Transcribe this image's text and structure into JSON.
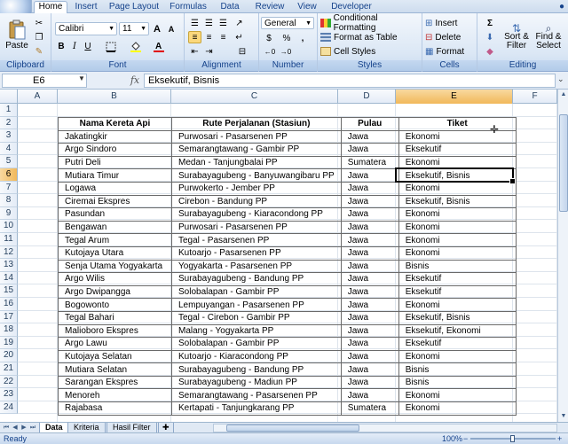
{
  "ribbon": {
    "tabs": [
      "Home",
      "Insert",
      "Page Layout",
      "Formulas",
      "Data",
      "Review",
      "View",
      "Developer"
    ],
    "active_tab": "Home",
    "clipboard": {
      "label": "Clipboard",
      "paste": "Paste"
    },
    "font": {
      "label": "Font",
      "name": "Calibri",
      "size": "11",
      "bold": "B",
      "italic": "I",
      "underline": "U"
    },
    "alignment": {
      "label": "Alignment"
    },
    "number": {
      "label": "Number",
      "format": "General",
      "currency": "$",
      "percent": "%",
      "comma": ","
    },
    "styles": {
      "label": "Styles",
      "conditional": "Conditional Formatting",
      "format_table": "Format as Table",
      "cell_styles": "Cell Styles"
    },
    "cells": {
      "label": "Cells",
      "insert": "Insert",
      "delete": "Delete",
      "format": "Format"
    },
    "editing": {
      "label": "Editing",
      "sigma": "Σ",
      "sort": "Sort &",
      "filter": "Filter",
      "find": "Find &",
      "select": "Select"
    }
  },
  "formula_bar": {
    "name_box": "E6",
    "fx": "fx",
    "value": "Eksekutif, Bisnis"
  },
  "columns": [
    "A",
    "B",
    "C",
    "D",
    "E",
    "F"
  ],
  "selected_column": "E",
  "rows": [
    "1",
    "2",
    "3",
    "4",
    "5",
    "6",
    "7",
    "8",
    "9",
    "10",
    "11",
    "12",
    "13",
    "14",
    "15",
    "16",
    "17",
    "18",
    "19",
    "20",
    "21",
    "22",
    "23",
    "24"
  ],
  "selected_row": "6",
  "table": {
    "headers": [
      "Nama Kereta Api",
      "Rute Perjalanan (Stasiun)",
      "Pulau",
      "Tiket"
    ],
    "rows": [
      [
        "Jakatingkir",
        "Purwosari - Pasarsenen PP",
        "Jawa",
        "Ekonomi"
      ],
      [
        "Argo Sindoro",
        "Semarangtawang - Gambir PP",
        "Jawa",
        "Eksekutif"
      ],
      [
        "Putri Deli",
        "Medan - Tanjungbalai PP",
        "Sumatera",
        "Ekonomi"
      ],
      [
        "Mutiara Timur",
        "Surabayagubeng - Banyuwangibaru PP",
        "Jawa",
        "Eksekutif, Bisnis"
      ],
      [
        "Logawa",
        "Purwokerto - Jember PP",
        "Jawa",
        "Ekonomi"
      ],
      [
        "Ciremai Ekspres",
        "Cirebon - Bandung PP",
        "Jawa",
        "Eksekutif, Bisnis"
      ],
      [
        "Pasundan",
        "Surabayagubeng - Kiaracondong PP",
        "Jawa",
        "Ekonomi"
      ],
      [
        "Bengawan",
        "Purwosari - Pasarsenen PP",
        "Jawa",
        "Ekonomi"
      ],
      [
        "Tegal Arum",
        "Tegal - Pasarsenen PP",
        "Jawa",
        "Ekonomi"
      ],
      [
        "Kutojaya Utara",
        "Kutoarjo - Pasarsenen PP",
        "Jawa",
        "Ekonomi"
      ],
      [
        "Senja Utama Yogyakarta",
        "Yogyakarta - Pasarsenen PP",
        "Jawa",
        "Bisnis"
      ],
      [
        "Argo Wilis",
        "Surabayagubeng - Bandung PP",
        "Jawa",
        "Eksekutif"
      ],
      [
        "Argo Dwipangga",
        "Solobalapan - Gambir PP",
        "Jawa",
        "Eksekutif"
      ],
      [
        "Bogowonto",
        "Lempuyangan - Pasarsenen PP",
        "Jawa",
        "Ekonomi"
      ],
      [
        "Tegal Bahari",
        "Tegal - Cirebon - Gambir PP",
        "Jawa",
        "Eksekutif, Bisnis"
      ],
      [
        "Malioboro Ekspres",
        "Malang - Yogyakarta PP",
        "Jawa",
        "Eksekutif, Ekonomi"
      ],
      [
        "Argo Lawu",
        "Solobalapan - Gambir PP",
        "Jawa",
        "Eksekutif"
      ],
      [
        "Kutojaya Selatan",
        "Kutoarjo - Kiaracondong PP",
        "Jawa",
        "Ekonomi"
      ],
      [
        "Mutiara Selatan",
        "Surabayagubeng - Bandung PP",
        "Jawa",
        "Bisnis"
      ],
      [
        "Sarangan Ekspres",
        "Surabayagubeng - Madiun PP",
        "Jawa",
        "Bisnis"
      ],
      [
        "Menoreh",
        "Semarangtawang - Pasarsenen PP",
        "Jawa",
        "Ekonomi"
      ],
      [
        "Rajabasa",
        "Kertapati - Tanjungkarang PP",
        "Sumatera",
        "Ekonomi"
      ]
    ]
  },
  "sheets": [
    "Data",
    "Kriteria",
    "Hasil Filter"
  ],
  "active_sheet": "Data",
  "status": {
    "ready": "Ready",
    "zoom": "100%",
    "zoom_fraction": 0.5
  }
}
